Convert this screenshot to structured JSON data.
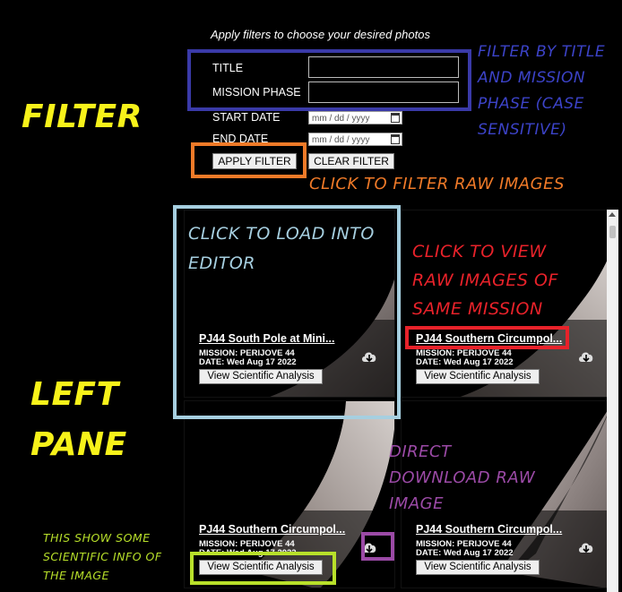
{
  "filter_panel": {
    "instructions": "Apply filters to choose your desired photos",
    "title_label": "TITLE",
    "title_value": "",
    "mission_label": "MISSION PHASE",
    "mission_value": "",
    "start_label": "START DATE",
    "start_placeholder": "mm / dd / yyyy",
    "end_label": "END DATE",
    "end_placeholder": "mm / dd / yyyy",
    "apply_button": "APPLY FILTER",
    "clear_button": "CLEAR FILTER"
  },
  "annotations": {
    "filter_heading": "FILTER",
    "left_pane_line1": "LEFT",
    "left_pane_line2": "PANE",
    "filter_by_title": [
      "FILTER BY TITLE",
      "AND MISSION",
      "PHASE (CASE",
      "SENSITIVE)"
    ],
    "click_to_filter": "CLICK TO FILTER RAW IMAGES",
    "click_to_load": [
      "CLICK TO LOAD INTO",
      "EDITOR"
    ],
    "click_to_view": [
      "CLICK TO VIEW",
      "RAW IMAGES OF",
      "SAME MISSION"
    ],
    "direct_download": [
      "DIRECT",
      "DOWNLOAD RAW",
      "IMAGE"
    ],
    "scientific_info": [
      "THIS SHOW SOME",
      "SCIENTIFIC INFO OF",
      "THE IMAGE"
    ]
  },
  "colors": {
    "blue_box": "#3a3aa8",
    "orange_box": "#f07a28",
    "light_blue_box": "#a6cfe0",
    "red_box": "#e8222a",
    "purple_box": "#9b4aa6",
    "green_box": "#b8e02a",
    "yellow_text": "#f7f21a",
    "blue_text": "#3c43c8",
    "orange_text": "#f07a28",
    "light_blue_text": "#a6cfe0",
    "red_text": "#e8222a",
    "purple_text": "#9b4aa6",
    "green_text": "#b8e02a"
  },
  "cards": [
    {
      "title": "PJ44 South Pole at Mini...",
      "mission": "MISSION: PERIJOVE 44",
      "date": "DATE: Wed Aug 17 2022",
      "button": "View Scientific Analysis",
      "icon": "cloud-download-icon"
    },
    {
      "title": "PJ44 Southern Circumpol...",
      "mission": "MISSION: PERIJOVE 44",
      "date": "DATE: Wed Aug 17 2022",
      "button": "View Scientific Analysis",
      "icon": "cloud-download-icon"
    },
    {
      "title": "PJ44 Southern Circumpol...",
      "mission": "MISSION: PERIJOVE 44",
      "date": "DATE: Wed Aug 17 2022",
      "button": "View Scientific Analysis",
      "icon": "cloud-download-icon"
    },
    {
      "title": "PJ44 Southern Circumpol...",
      "mission": "MISSION: PERIJOVE 44",
      "date": "DATE: Wed Aug 17 2022",
      "button": "View Scientific Analysis",
      "icon": "cloud-download-icon"
    }
  ]
}
